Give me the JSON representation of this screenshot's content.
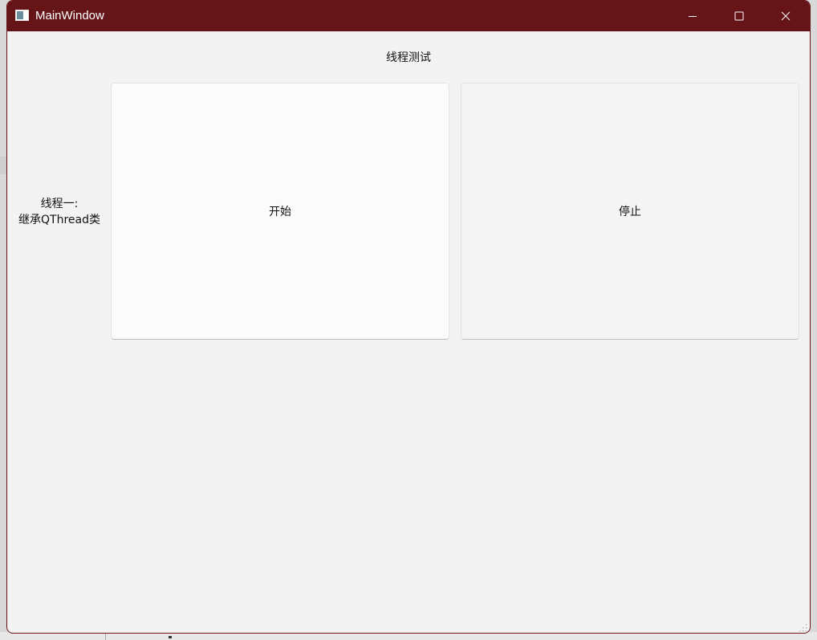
{
  "window": {
    "title": "MainWindow",
    "titlebar_color": "#651418",
    "controls": {
      "minimize_icon": "minimize-icon",
      "maximize_icon": "maximize-icon",
      "close_icon": "close-icon"
    }
  },
  "main": {
    "header": "线程测试",
    "row_label_line1": "线程一:",
    "row_label_line2": "继承QThread类",
    "start_button": "开始",
    "stop_button": "停止"
  }
}
